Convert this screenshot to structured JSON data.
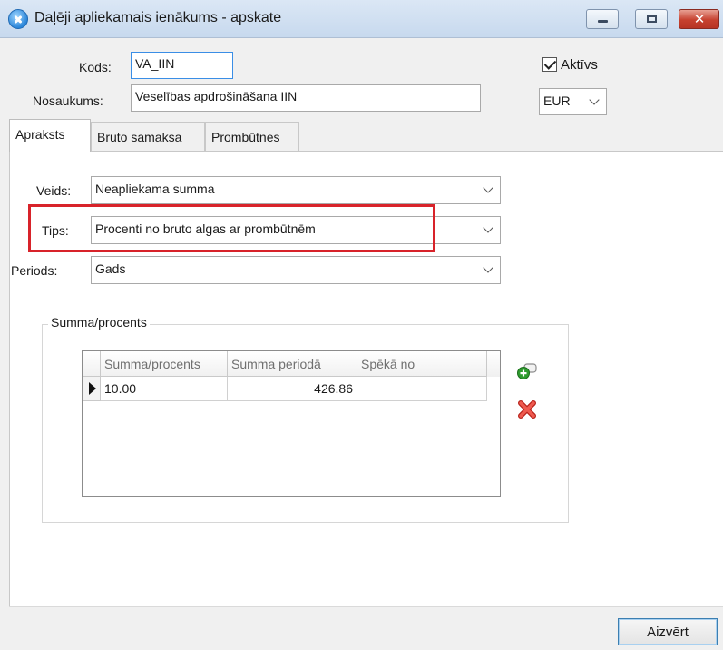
{
  "window": {
    "title": "Daļēji apliekamais ienākums - apskate"
  },
  "form": {
    "kods_label": "Kods:",
    "kods_value": "VA_IIN",
    "nosaukums_label": "Nosaukums:",
    "nosaukums_value": "Veselības apdrošināšana IIN",
    "aktivs_label": "Aktīvs",
    "aktivs_checked": true,
    "currency_value": "EUR"
  },
  "tabs": [
    {
      "label": "Apraksts",
      "active": true
    },
    {
      "label": "Bruto samaksa",
      "active": false
    },
    {
      "label": "Prombūtnes",
      "active": false
    }
  ],
  "details": {
    "veids_label": "Veids:",
    "veids_value": "Neapliekama summa",
    "tips_label": "Tips:",
    "tips_value": "Procenti no bruto algas ar prombūtnēm",
    "periods_label": "Periods:",
    "periods_value": "Gads"
  },
  "group": {
    "title": "Summa/procents",
    "columns": [
      "Summa/procents",
      "Summa periodā",
      "Spēkā no"
    ],
    "rows": [
      {
        "summa_procents": "10.00",
        "summa_perioda": "426.86",
        "speka_no": ""
      }
    ]
  },
  "footer": {
    "close_label": "Aizvērt"
  },
  "colors": {
    "highlight": "#d8232a",
    "add_icon": "#2e9b2e",
    "delete_icon": "#d9342b"
  },
  "icons": {
    "add": "add-row-icon",
    "delete": "delete-row-icon"
  }
}
